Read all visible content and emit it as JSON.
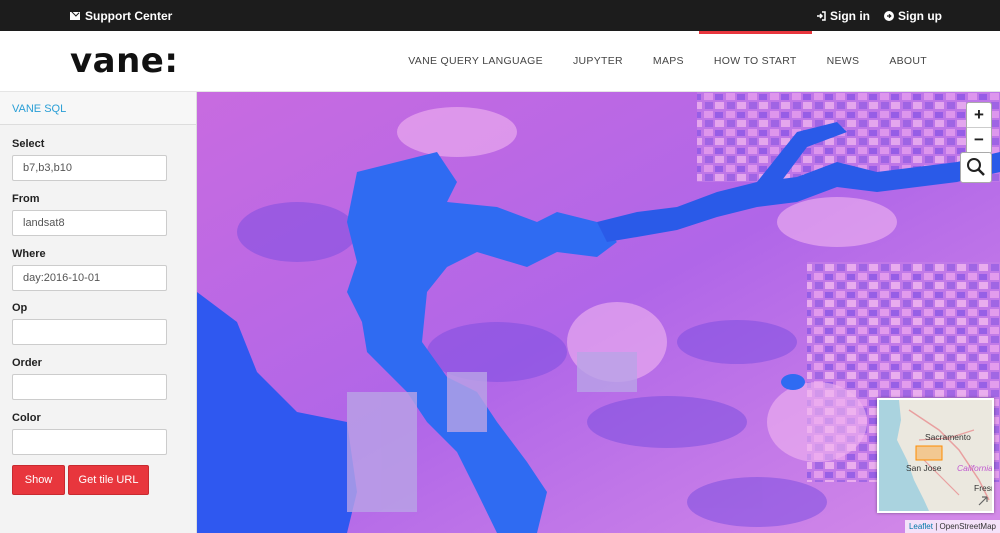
{
  "topbar": {
    "support_label": "Support Center",
    "signin_label": "Sign in",
    "signup_label": "Sign up"
  },
  "nav": {
    "logo": "vane:",
    "items": [
      {
        "label": "VANE QUERY LANGUAGE"
      },
      {
        "label": "JUPYTER"
      },
      {
        "label": "MAPS"
      },
      {
        "label": "HOW TO START"
      },
      {
        "label": "NEWS"
      },
      {
        "label": "ABOUT"
      }
    ],
    "active_item": "HOW TO START",
    "accent_color": "#e8363d"
  },
  "sidebar": {
    "title": "VANE SQL",
    "fields": [
      {
        "label": "Select",
        "value": "b7,b3,b10"
      },
      {
        "label": "From",
        "value": "landsat8"
      },
      {
        "label": "Where",
        "value": "day:2016-10-01"
      },
      {
        "label": "Op",
        "value": ""
      },
      {
        "label": "Order",
        "value": ""
      },
      {
        "label": "Color",
        "value": ""
      }
    ],
    "show_button": "Show",
    "tile_button": "Get tile URL"
  },
  "map": {
    "zoom_in": "+",
    "zoom_out": "−",
    "search_icon": "search-icon",
    "minimap": {
      "labels": [
        "Sacramento",
        "San Jose",
        "California",
        "Fresno"
      ]
    },
    "attribution_leaflet": "Leaflet",
    "attribution_sep": " | ",
    "attribution_osm": "OpenStreetMap"
  }
}
